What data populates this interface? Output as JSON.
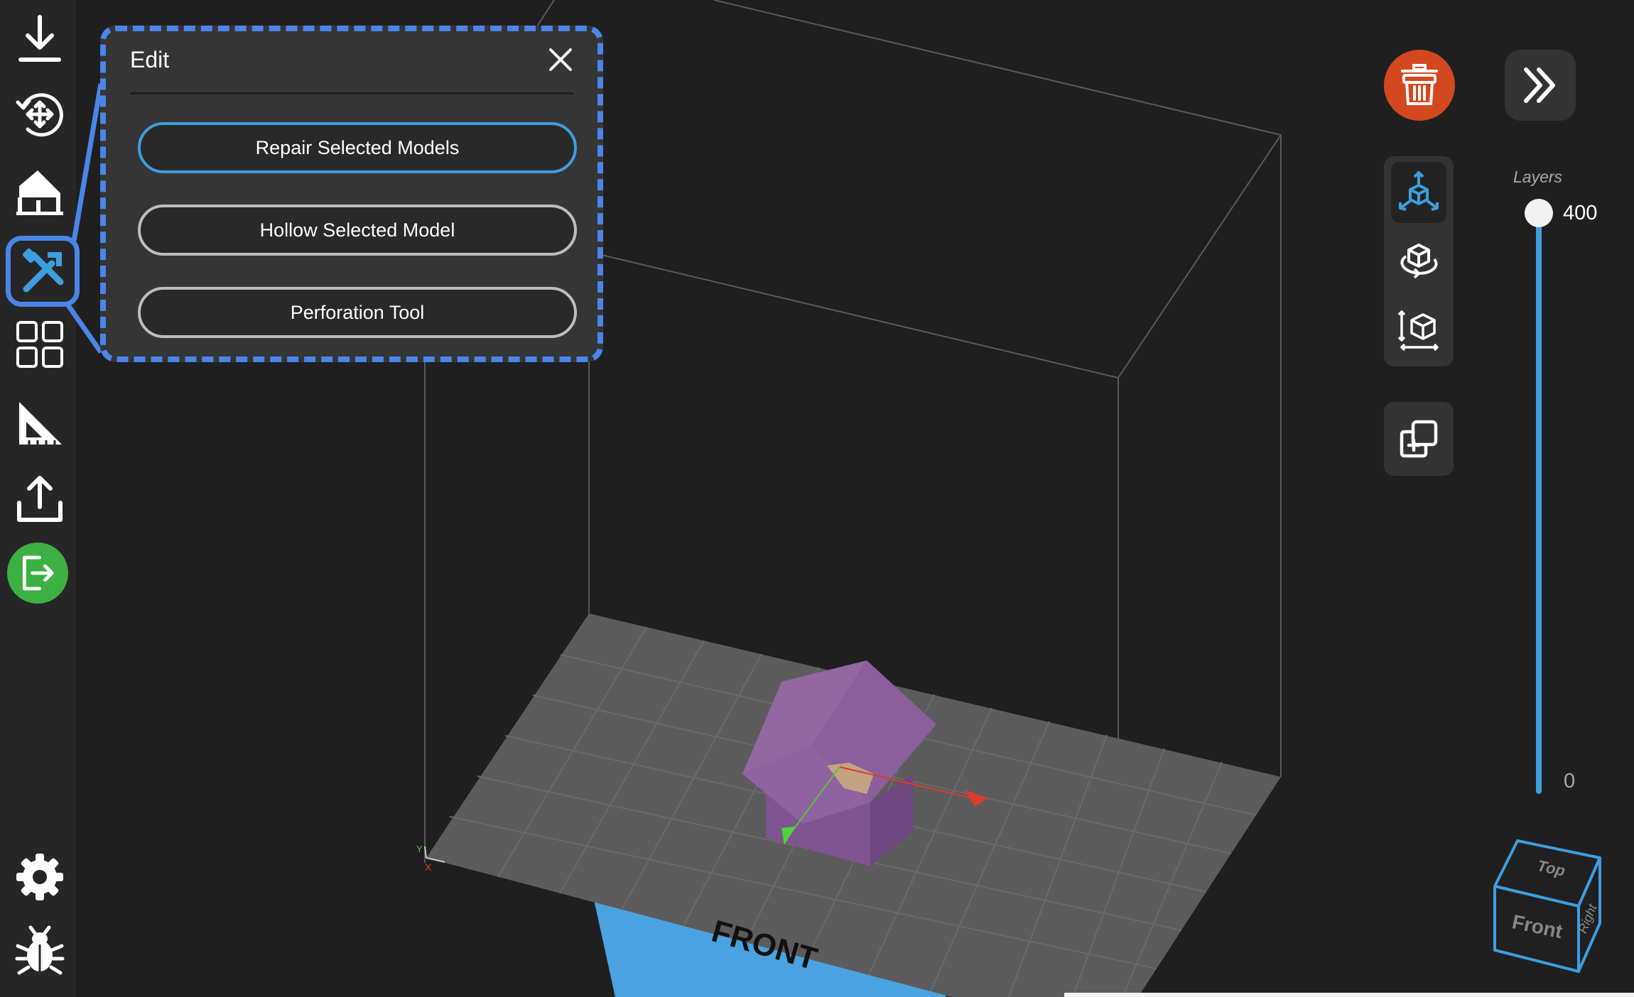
{
  "edit_panel": {
    "title": "Edit",
    "buttons": [
      {
        "label": "Repair Selected Models",
        "active": true
      },
      {
        "label": "Hollow Selected Model",
        "active": false
      },
      {
        "label": "Perforation Tool",
        "active": false
      }
    ]
  },
  "sidebar": {
    "items": [
      {
        "name": "import",
        "icon": "download-icon"
      },
      {
        "name": "transform",
        "icon": "rotate-move-icon"
      },
      {
        "name": "supports",
        "icon": "support-icon"
      },
      {
        "name": "edit",
        "icon": "tools-icon",
        "active": true
      },
      {
        "name": "arrange",
        "icon": "grid-icon"
      },
      {
        "name": "measure",
        "icon": "set-square-icon"
      },
      {
        "name": "export",
        "icon": "upload-icon"
      },
      {
        "name": "exit",
        "icon": "exit-icon"
      },
      {
        "name": "settings",
        "icon": "gear-icon"
      },
      {
        "name": "debug",
        "icon": "bug-icon"
      }
    ]
  },
  "layers": {
    "label": "Layers",
    "max": "400",
    "min": "0",
    "value": 400
  },
  "scene": {
    "platform_label": "FRONT"
  },
  "view_cube": {
    "top": "Top",
    "front": "Front",
    "right": "Right"
  },
  "colors": {
    "accent": "#3d9ee0",
    "highlight": "#4a86e8",
    "delete": "#d4481f",
    "exit": "#3cb043",
    "model": "#8b5e9b",
    "platform": "#5c5c5c"
  }
}
